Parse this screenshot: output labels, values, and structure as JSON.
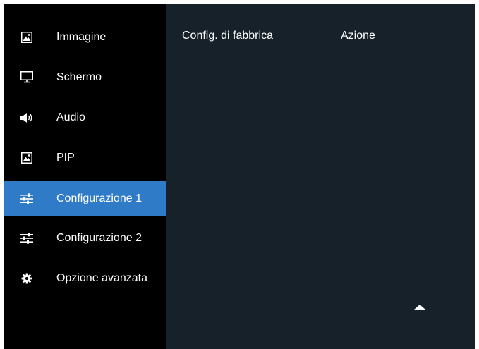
{
  "sidebar": {
    "items": [
      {
        "label": "Immagine",
        "icon": "picture-icon",
        "selected": false
      },
      {
        "label": "Schermo",
        "icon": "monitor-icon",
        "selected": false
      },
      {
        "label": "Audio",
        "icon": "speaker-icon",
        "selected": false
      },
      {
        "label": "PIP",
        "icon": "picture-icon",
        "selected": false
      },
      {
        "label": "Configurazione 1",
        "icon": "sliders-icon",
        "selected": true
      },
      {
        "label": "Configurazione 2",
        "icon": "sliders-icon",
        "selected": false
      },
      {
        "label": "Opzione avanzata",
        "icon": "gear-icon",
        "selected": false
      }
    ]
  },
  "main": {
    "column_setting": "Config. di fabbrica",
    "column_action": "Azione",
    "scroll_up_icon": "triangle-up-icon"
  },
  "colors": {
    "sidebar_bg": "#000000",
    "main_bg": "#17212a",
    "selected_bg": "#2f7bc8",
    "text": "#ffffff"
  }
}
